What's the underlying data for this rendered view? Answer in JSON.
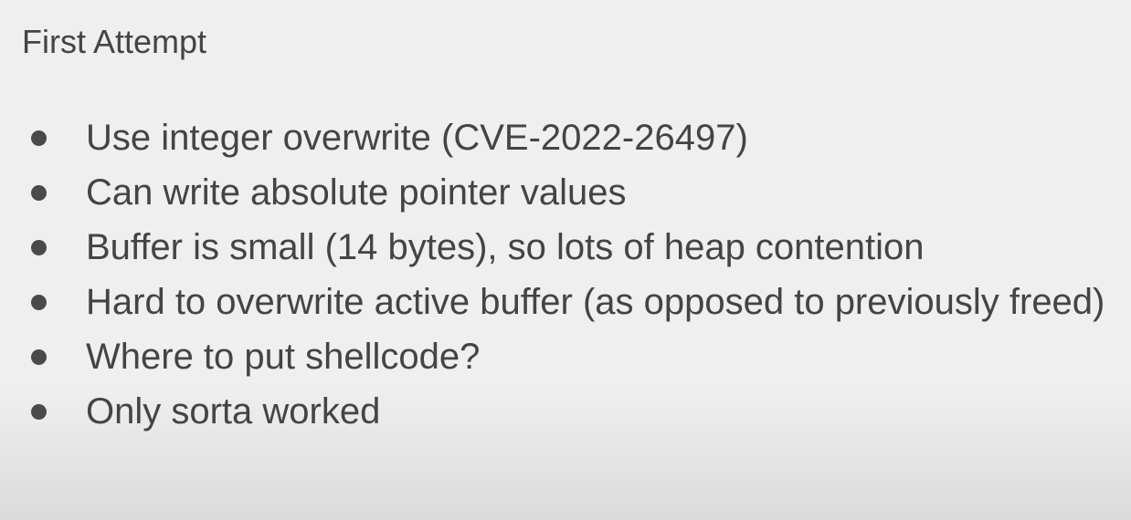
{
  "slide": {
    "title": "First Attempt",
    "bullets": [
      "Use integer overwrite (CVE-2022-26497)",
      "Can write absolute pointer values",
      "Buffer is small (14 bytes), so lots of heap contention",
      "Hard to overwrite active buffer (as opposed to previously freed)",
      "Where to put shellcode?",
      "Only sorta worked"
    ]
  },
  "colors": {
    "background": "#efefef",
    "text": "#444444"
  }
}
